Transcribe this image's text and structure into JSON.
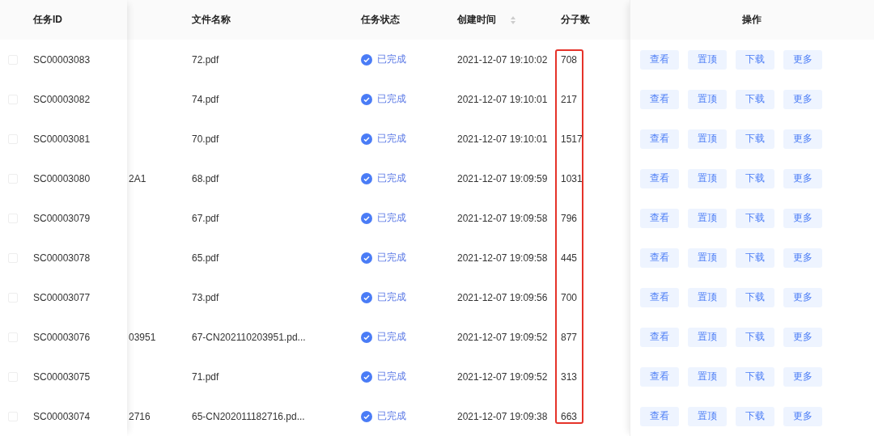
{
  "columns": [
    {
      "label": "任务ID",
      "sortable": false,
      "highlighted": false
    },
    {
      "label": "文件名称",
      "sortable": false,
      "highlighted": false
    },
    {
      "label": "任务状态",
      "sortable": false,
      "highlighted": false
    },
    {
      "label": "创建时间",
      "sortable": true,
      "highlighted": false
    },
    {
      "label": "分子数",
      "sortable": false,
      "highlighted": true
    },
    {
      "label": "操作",
      "sortable": false,
      "highlighted": false
    }
  ],
  "rows": [
    {
      "checked": false,
      "task_id": "SC00003083",
      "file_name": "72.pdf",
      "status": {
        "kind": "done",
        "label": "已完成"
      },
      "created": "2021-12-07 19:10:02",
      "molecules": "708",
      "actions": [
        "查看",
        "置顶",
        "下载",
        "更多"
      ]
    },
    {
      "checked": false,
      "task_id": "SC00003082",
      "file_name": "74.pdf",
      "status": {
        "kind": "done",
        "label": "已完成"
      },
      "created": "2021-12-07 19:10:01",
      "molecules": "217",
      "actions": [
        "查看",
        "置顶",
        "下载",
        "更多"
      ]
    },
    {
      "checked": false,
      "task_id": "SC00003081",
      "file_name": "70.pdf",
      "status": {
        "kind": "done",
        "label": "已完成"
      },
      "created": "2021-12-07 19:10:01",
      "molecules": "1517",
      "actions": [
        "查看",
        "置顶",
        "下载",
        "更多"
      ]
    },
    {
      "checked": false,
      "task_id": "SC00003080",
      "column_2": "2A1",
      "file_name": "68.pdf",
      "status": {
        "kind": "done",
        "label": "已完成"
      },
      "created": "2021-12-07 19:09:59",
      "molecules": "1031",
      "actions": [
        "查看",
        "置顶",
        "下载",
        "更多"
      ]
    },
    {
      "checked": false,
      "task_id": "SC00003079",
      "file_name": "67.pdf",
      "status": {
        "kind": "done",
        "label": "已完成"
      },
      "created": "2021-12-07 19:09:58",
      "molecules": "796",
      "actions": [
        "查看",
        "置顶",
        "下载",
        "更多"
      ]
    },
    {
      "checked": false,
      "task_id": "SC00003078",
      "file_name": "65.pdf",
      "status": {
        "kind": "done",
        "label": "已完成"
      },
      "created": "2021-12-07 19:09:58",
      "molecules": "445",
      "actions": [
        "查看",
        "置顶",
        "下载",
        "更多"
      ]
    },
    {
      "checked": false,
      "task_id": "SC00003077",
      "file_name": "73.pdf",
      "status": {
        "kind": "done",
        "label": "已完成"
      },
      "created": "2021-12-07 19:09:56",
      "molecules": "700",
      "actions": [
        "查看",
        "置顶",
        "下载",
        "更多"
      ]
    },
    {
      "checked": false,
      "task_id": "SC00003076",
      "column_2": "03951",
      "file_name": "67-CN202110203951.pd...",
      "status": {
        "kind": "done",
        "label": "已完成"
      },
      "created": "2021-12-07 19:09:52",
      "molecules": "877",
      "actions": [
        "查看",
        "置顶",
        "下载",
        "更多"
      ]
    },
    {
      "checked": false,
      "task_id": "SC00003075",
      "file_name": "71.pdf",
      "status": {
        "kind": "done",
        "label": "已完成"
      },
      "created": "2021-12-07 19:09:52",
      "molecules": "313",
      "actions": [
        "查看",
        "置顶",
        "下载",
        "更多"
      ]
    },
    {
      "checked": false,
      "task_id": "SC00003074",
      "column_2": "2716",
      "file_name": "65-CN202011182716.pd...",
      "status": {
        "kind": "done",
        "label": "已完成"
      },
      "created": "2021-12-07 19:09:38",
      "molecules": "663",
      "actions": [
        "查看",
        "置顶",
        "下载",
        "更多"
      ]
    }
  ]
}
